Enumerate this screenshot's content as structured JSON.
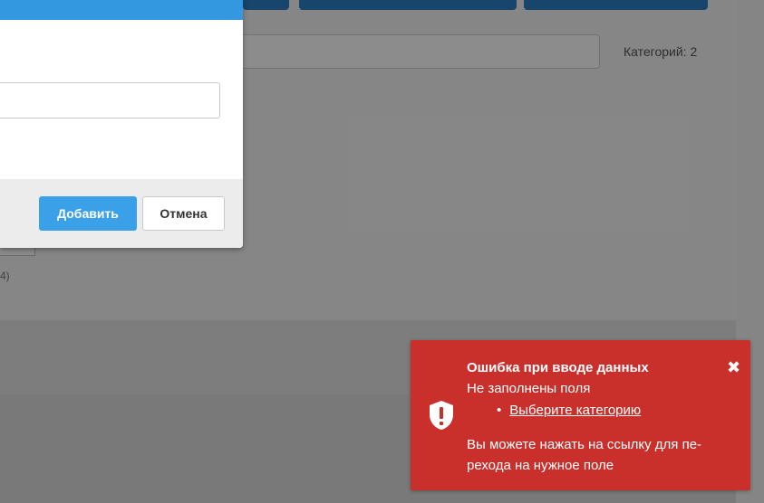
{
  "background": {
    "category_count_label": "Категорий: 2",
    "fragment_text": "4)"
  },
  "modal": {
    "add_button_label": "Добавить",
    "cancel_button_label": "Отмена",
    "input_value": ""
  },
  "toast": {
    "title": "Ошибка при вводе данных",
    "subtitle": "Не заполнены поля",
    "missing_fields": [
      "Выберите категорию"
    ],
    "hint_line1": "Вы можете нажать на ссылку для пе-",
    "hint_line2": "рехода на нужное поле",
    "close_icon": "close-icon",
    "shield_icon": "shield-alert-icon",
    "color": "#c9302c"
  },
  "colors": {
    "primary": "#3498e0",
    "danger": "#c9302c"
  }
}
